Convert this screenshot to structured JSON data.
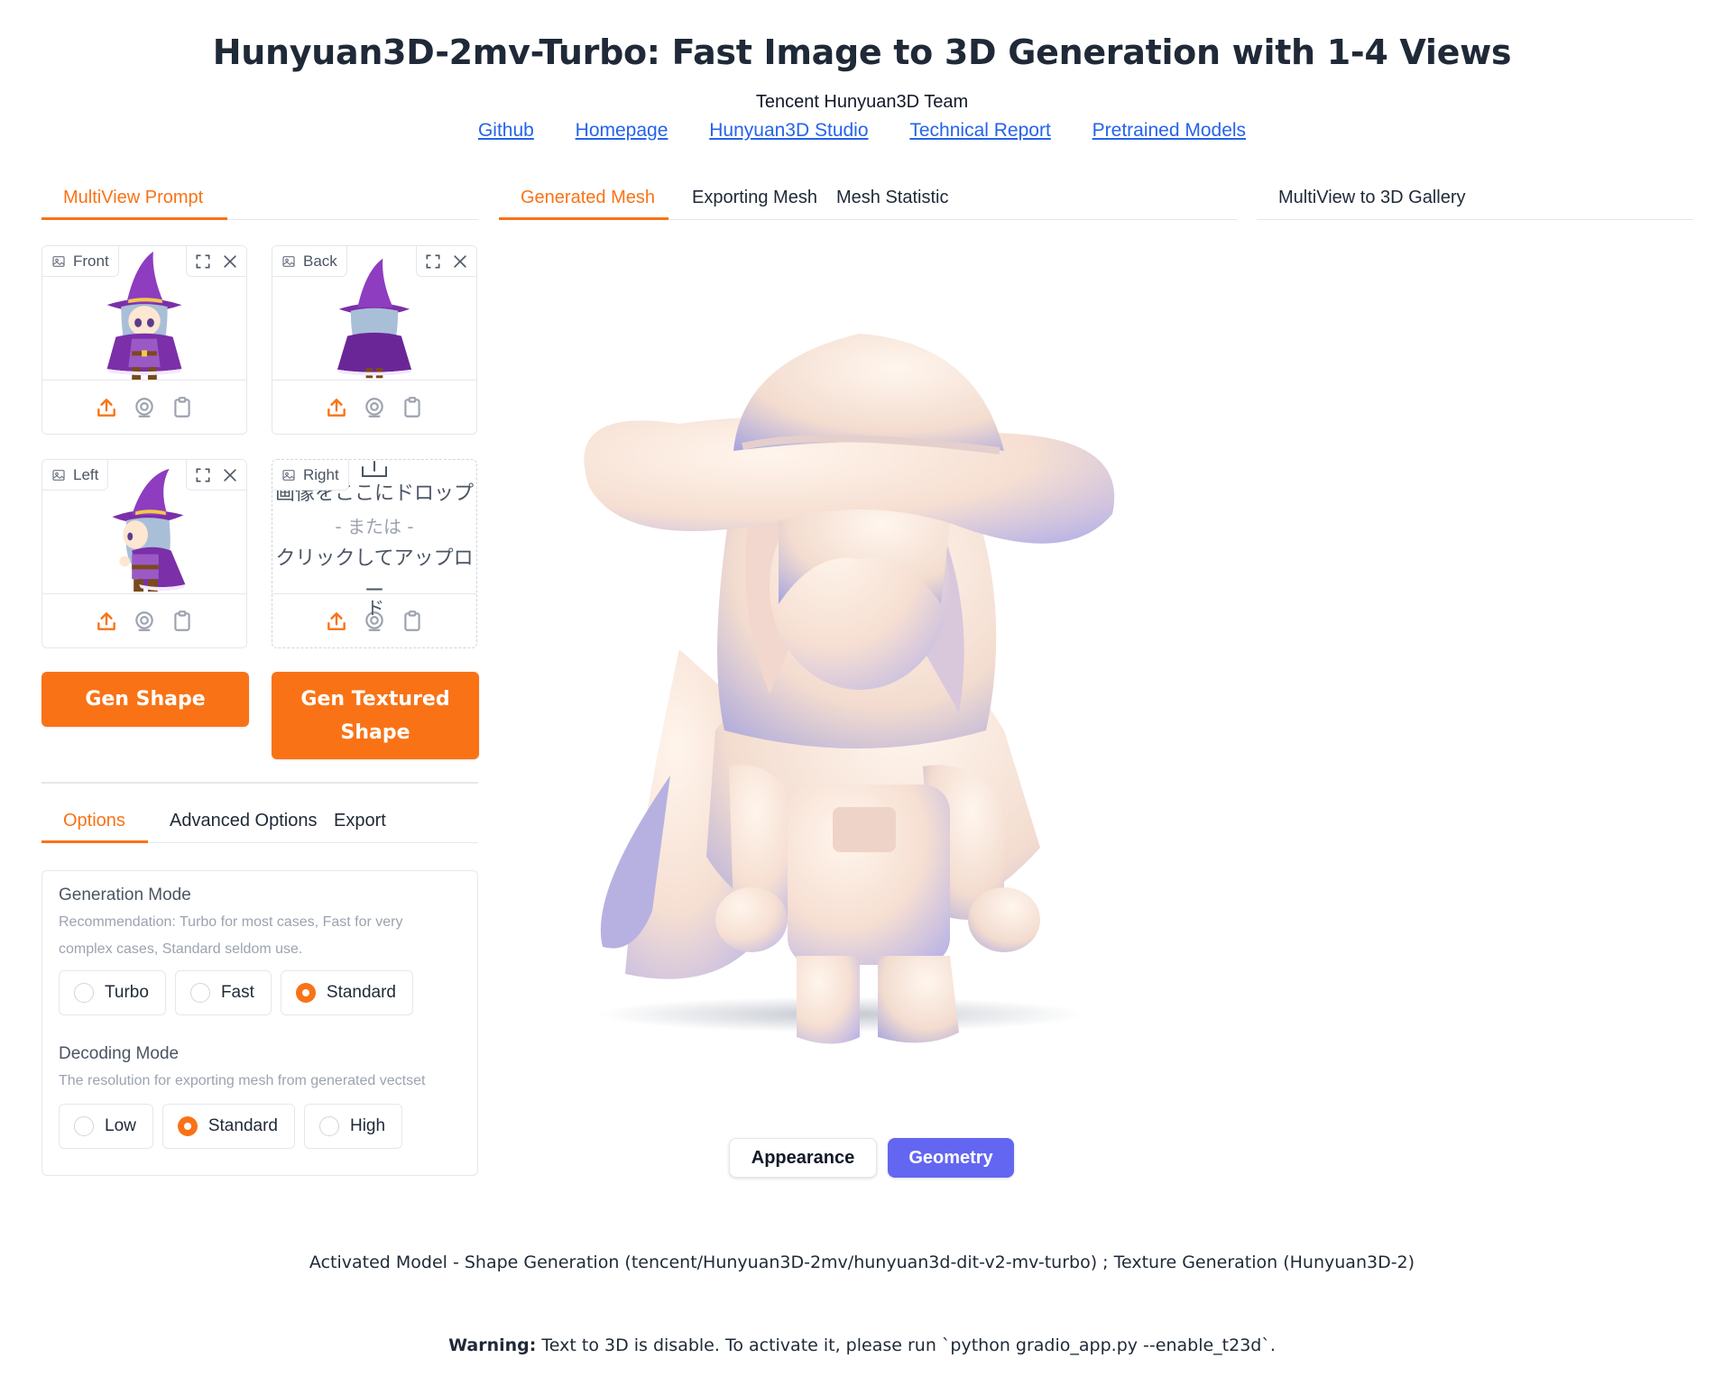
{
  "header": {
    "title": "Hunyuan3D-2mv-Turbo: Fast Image to 3D Generation with 1-4 Views",
    "subtitle": "Tencent Hunyuan3D Team",
    "links": [
      "Github",
      "Homepage",
      "Hunyuan3D Studio",
      "Technical Report",
      "Pretrained Models"
    ]
  },
  "left": {
    "tab": "MultiView Prompt",
    "views": {
      "front": "Front",
      "back": "Back",
      "left": "Left",
      "right": "Right"
    },
    "drop": {
      "line1": "画像をここにドロップ",
      "or": "- または -",
      "line2": "クリックしてアップロー",
      "line3": "ド"
    },
    "gen_shape": "Gen Shape",
    "gen_textured_1": "Gen Textured",
    "gen_textured_2": "Shape",
    "option_tabs": [
      "Options",
      "Advanced Options",
      "Export"
    ],
    "generation_mode": {
      "label": "Generation Mode",
      "info": "Recommendation: Turbo for most cases, Fast for very complex cases, Standard seldom use.",
      "options": [
        "Turbo",
        "Fast",
        "Standard"
      ],
      "selected": "Standard"
    },
    "decoding_mode": {
      "label": "Decoding Mode",
      "info": "The resolution for exporting mesh from generated vectset",
      "options": [
        "Low",
        "Standard",
        "High"
      ],
      "selected": "Standard"
    }
  },
  "center": {
    "tabs": [
      "Generated Mesh",
      "Exporting Mesh",
      "Mesh Statistic"
    ],
    "appearance": "Appearance",
    "geometry": "Geometry"
  },
  "right": {
    "tab": "MultiView to 3D Gallery"
  },
  "footer": {
    "model": "Activated Model - Shape Generation (tencent/Hunyuan3D-2mv/hunyuan3d-dit-v2-mv-turbo) ; Texture Generation (Hunyuan3D-2)",
    "warning_label": "Warning:",
    "warning_text": " Text to 3D is disable. To activate it, please run `python gradio_app.py --enable_t23d`."
  },
  "colors": {
    "accent": "#f97316",
    "link": "#2563eb",
    "geometry_btn": "#6366f1"
  }
}
